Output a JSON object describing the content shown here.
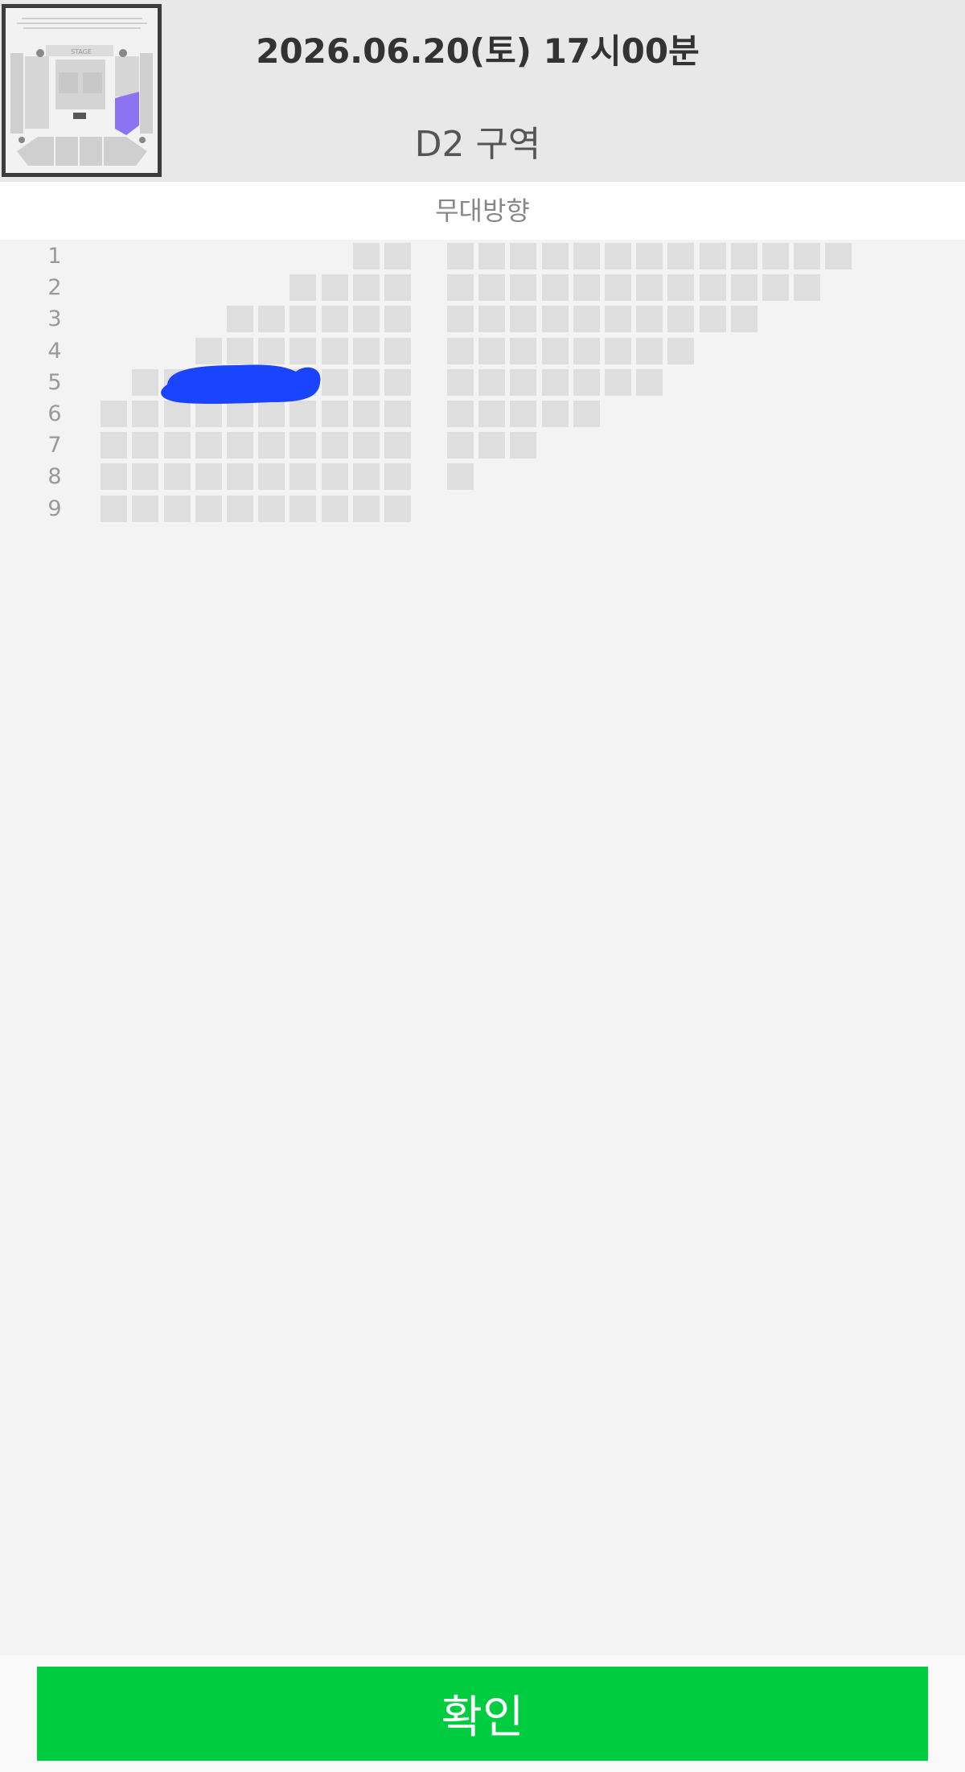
{
  "header": {
    "date_time": "2026.06.20(토) 17시00분",
    "zone": "D2 구역"
  },
  "minimap": {
    "stage_label": "STAGE",
    "highlighted_section": "D2",
    "highlight_color": "#8b73f2"
  },
  "stage_direction": "무대방향",
  "seat_map": {
    "seat_color": "#dedede",
    "rows": [
      {
        "label": "1",
        "left_block_seats": 2,
        "right_block_seats": 13
      },
      {
        "label": "2",
        "left_block_seats": 4,
        "right_block_seats": 12
      },
      {
        "label": "3",
        "left_block_seats": 6,
        "right_block_seats": 10
      },
      {
        "label": "4",
        "left_block_seats": 7,
        "right_block_seats": 8
      },
      {
        "label": "5",
        "left_block_seats": 9,
        "right_block_seats": 7
      },
      {
        "label": "6",
        "left_block_seats": 10,
        "right_block_seats": 5
      },
      {
        "label": "7",
        "left_block_seats": 10,
        "right_block_seats": 3
      },
      {
        "label": "8",
        "left_block_seats": 10,
        "right_block_seats": 1
      },
      {
        "label": "9",
        "left_block_seats": 10,
        "right_block_seats": 0
      }
    ],
    "redaction_color": "#1a44ff"
  },
  "confirm_button": {
    "label": "확인",
    "color": "#00cc40"
  }
}
